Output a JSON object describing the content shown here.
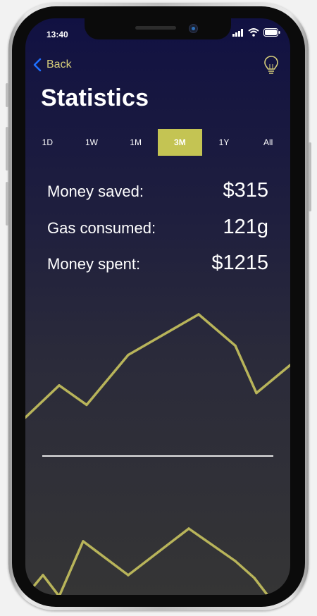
{
  "status_bar": {
    "time": "13:40"
  },
  "nav": {
    "back_label": "Back"
  },
  "page": {
    "title": "Statistics"
  },
  "range_tabs": [
    {
      "label": "1D",
      "active": false
    },
    {
      "label": "1W",
      "active": false
    },
    {
      "label": "1M",
      "active": false
    },
    {
      "label": "3M",
      "active": true
    },
    {
      "label": "1Y",
      "active": false
    },
    {
      "label": "All",
      "active": false
    }
  ],
  "stats": [
    {
      "label": "Money saved:",
      "value": "$315"
    },
    {
      "label": "Gas consumed:",
      "value": "121g"
    },
    {
      "label": "Money spent:",
      "value": "$1215"
    }
  ],
  "colors": {
    "accent": "#c4c453",
    "line": "#b8b45a",
    "back_text": "#d6cd7a",
    "back_chevron": "#1f6fff"
  },
  "icons": {
    "back": "chevron-left-icon",
    "hint": "lightbulb-icon"
  },
  "chart_data": [
    {
      "type": "line",
      "x": [
        0,
        1,
        2,
        3,
        4,
        5,
        6,
        7
      ],
      "values": [
        18,
        56,
        33,
        92,
        140,
        103,
        47,
        80
      ]
    },
    {
      "type": "line",
      "x": [
        0,
        1,
        2,
        3,
        4,
        5,
        6,
        7,
        8,
        9
      ],
      "values": [
        0,
        30,
        0,
        78,
        30,
        96,
        50,
        26,
        0,
        0
      ]
    }
  ]
}
